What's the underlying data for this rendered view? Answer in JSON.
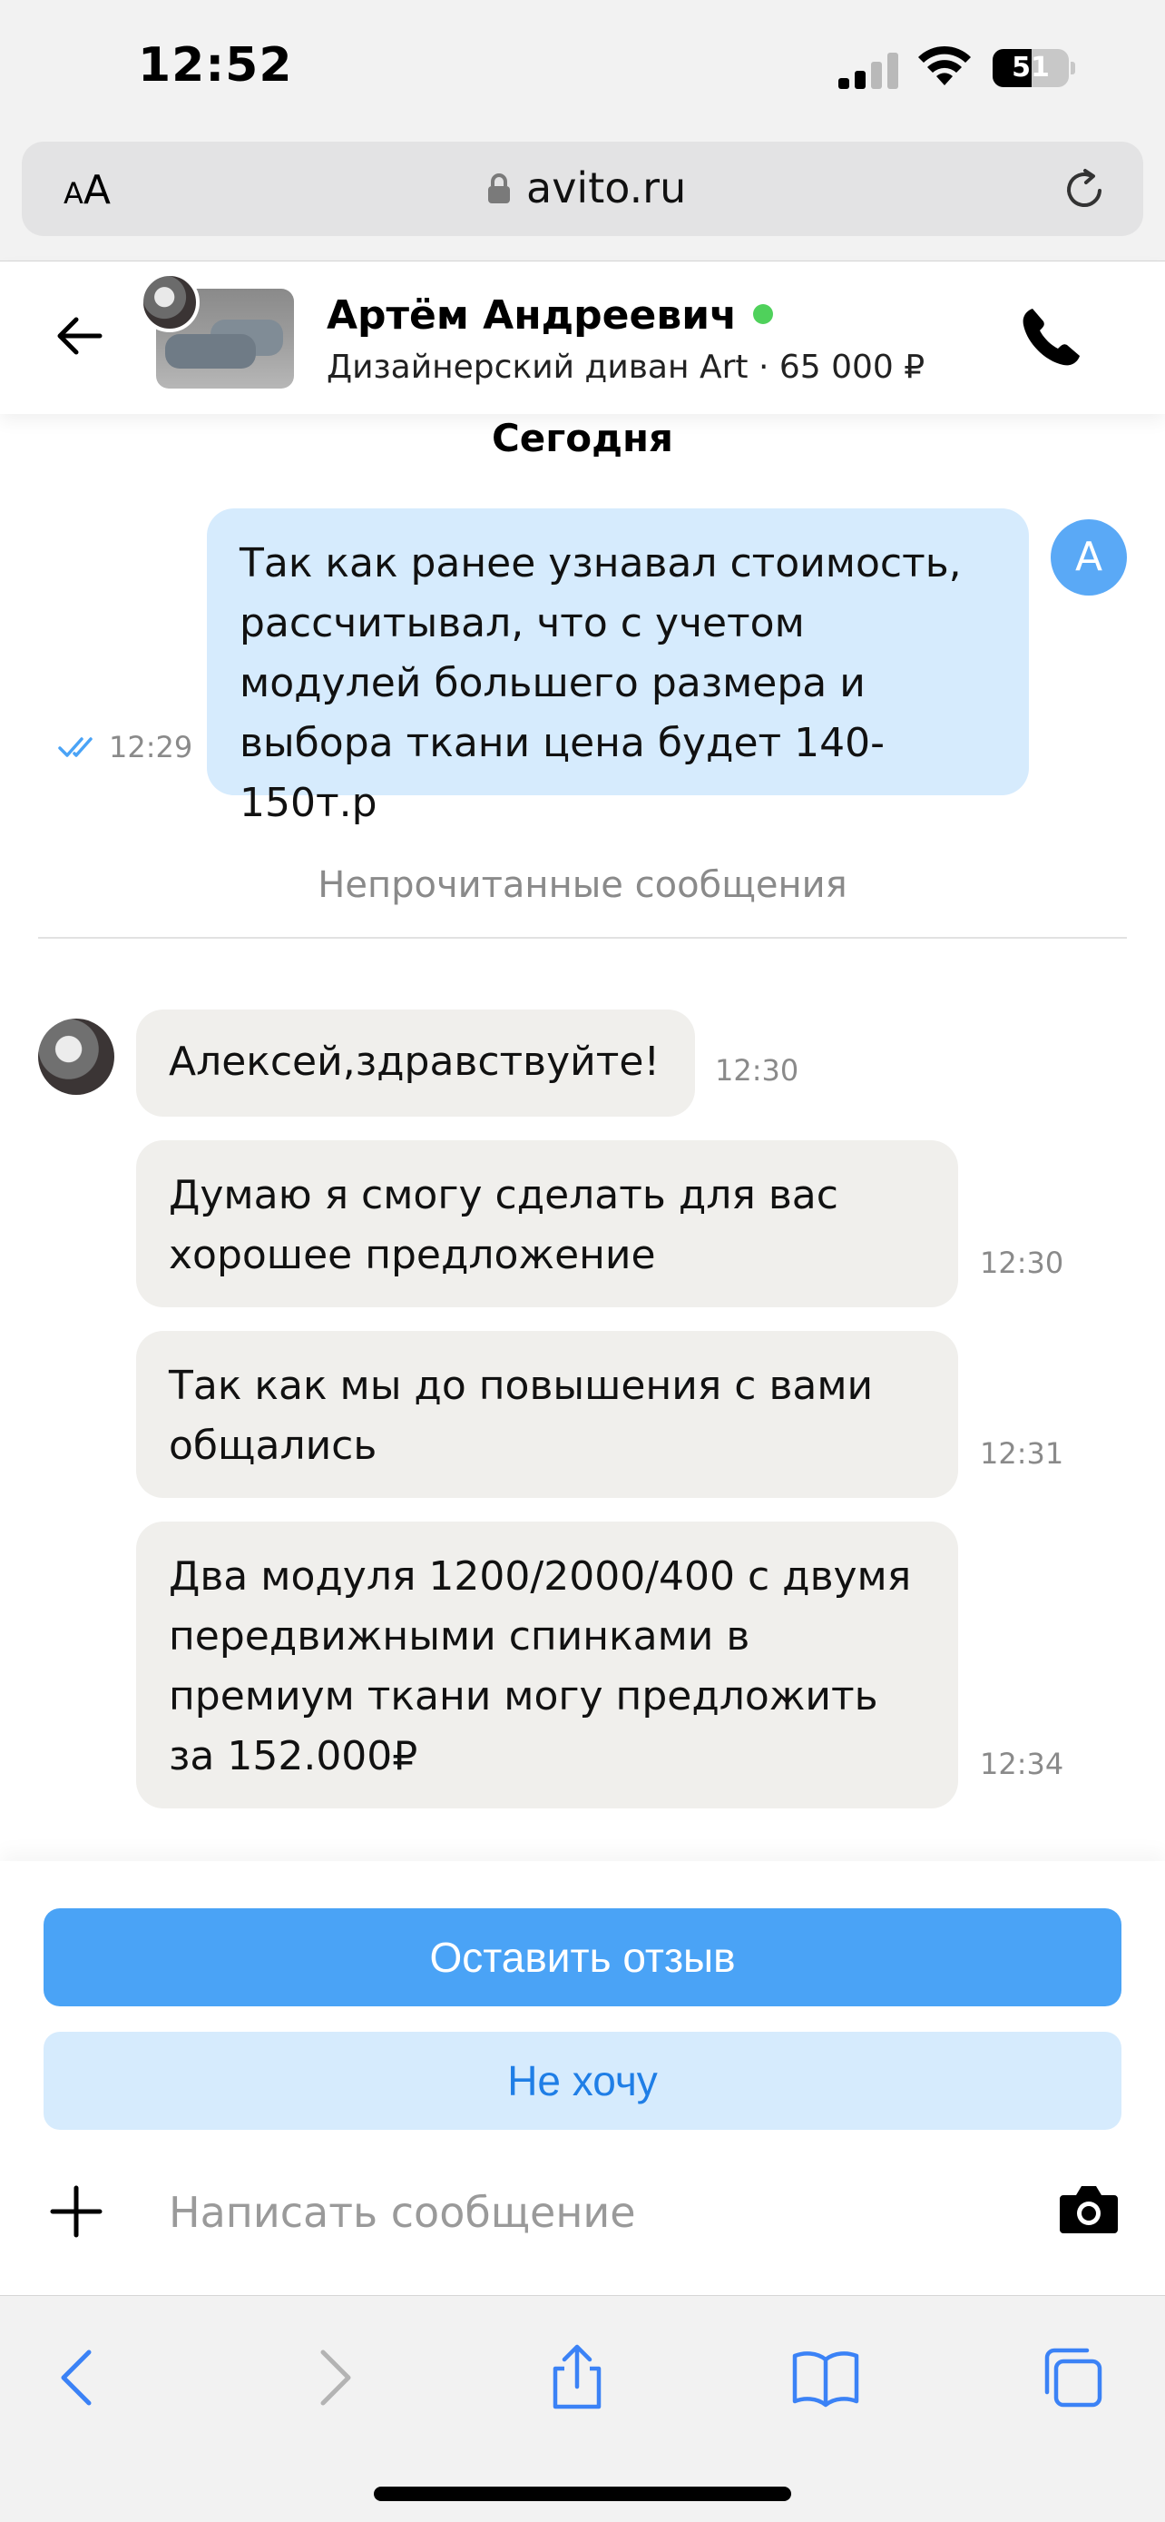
{
  "status_bar": {
    "time": "12:52",
    "battery_level": "51"
  },
  "browser": {
    "text_size_label_small": "A",
    "text_size_label_large": "A",
    "url": "avito.ru"
  },
  "chat": {
    "seller_name": "Артём Андреевич",
    "seller_online": true,
    "item_line": "Дизайнерский диван Art · 65 000 ₽",
    "day_label": "Сегодня",
    "my_avatar_initial": "A",
    "outgoing": {
      "text": "Так как ранее узнавал стоимость, рассчитывал, что с учетом модулей большего размера и выбора ткани цена будет 140-150т.р",
      "time": "12:29",
      "read": true
    },
    "unread_divider": "Непрочитанные сообщения",
    "incoming": [
      {
        "text": "Алексей,здравствуйте!",
        "time": "12:30"
      },
      {
        "text": "Думаю я смогу сделать для вас хорошее предложение",
        "time": "12:30"
      },
      {
        "text": "Так как мы до повышения с вами общались",
        "time": "12:31"
      },
      {
        "text": "Два модуля 1200/2000/400 с двумя передвижными спинками  в премиум ткани могу предложить за 152.000₽",
        "time": "12:34"
      }
    ]
  },
  "actions": {
    "leave_review": "Оставить отзыв",
    "decline": "Не хочу"
  },
  "composer": {
    "placeholder": "Написать сообщение",
    "value": ""
  },
  "colors": {
    "accent": "#4aa3f6",
    "accent_light": "#d6ebfd",
    "incoming_bubble": "#f0efec",
    "online": "#4fd15b",
    "ios_blue": "#3b82f6"
  },
  "icons": {
    "back": "arrow-left-icon",
    "call": "phone-icon",
    "lock": "lock-icon",
    "reload": "reload-icon",
    "plus": "plus-icon",
    "camera": "camera-icon",
    "read_receipt": "double-check-icon"
  }
}
